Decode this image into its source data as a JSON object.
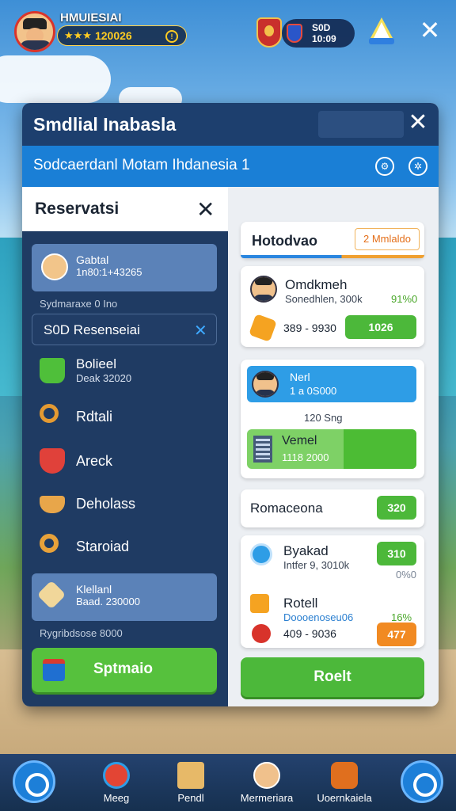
{
  "hud": {
    "player_name": "HMUIESIAI",
    "stars": "★★★",
    "rating_value": "120026",
    "currency_top": "S0D",
    "currency_bottom": "10:09"
  },
  "panel": {
    "title": "Smdlial Inabasla",
    "subtitle": "Sodcaerdanl Motam Ihdanesia 1"
  },
  "reservation": {
    "title": "Reservatsi",
    "profile_name": "Gabtal",
    "profile_detail": "1n80:1+43265",
    "hint": "Sydmaraxe 0 Ino",
    "search_value": "S0D Resenseiai",
    "menu": [
      {
        "label": "Bolieel",
        "sub": "Deak 32020"
      },
      {
        "label": "Rdtali"
      },
      {
        "label": "Areck"
      },
      {
        "label": "Deholass"
      },
      {
        "label": "Staroiad"
      }
    ],
    "highlight_name": "Klellanl",
    "highlight_detail": "Baad. 230000",
    "footer_note": "Rygribdsose 8000",
    "confirm_button": "Sptmaio"
  },
  "hotels": {
    "header_title": "Hotodvao",
    "header_badge": "2 Mmlaldo",
    "card1_name": "Omdkmeh",
    "card1_detail": "Sonedhlen, 300k",
    "card1_percent": "91%0",
    "card1_range": "389 - 9930",
    "card1_button": "1026",
    "card2_name": "Nerl",
    "card2_detail": "1 a 0S000",
    "card2_note": "120 Sng",
    "card2_sub_name": "Vemel",
    "card2_sub_detail": "1118 2000",
    "section_title": "Romaceona",
    "section_button": "320",
    "item1_name": "Byakad",
    "item1_detail": "Intfer 9, 3010k",
    "item1_percent": "0%0",
    "item1_button": "310",
    "item2_name": "Rotell",
    "item2_detail": "Doooenoseu06",
    "item2_percent": "16%",
    "item2_range": "409 - 9036",
    "item2_button": "477",
    "book_button": "Roelt"
  },
  "bottom_nav": [
    {
      "label": "Meeg"
    },
    {
      "label": "Pendl"
    },
    {
      "label": "Mermeriara"
    },
    {
      "label": "Uoernkaiela"
    }
  ],
  "icons": {
    "settings": "gear-icon",
    "compass": "compass-icon",
    "close": "close-icon"
  },
  "colors": {
    "header": "#1d3f6e",
    "accent_blue": "#1a7fd6",
    "accent_green": "#4cb83a",
    "accent_orange": "#f18a22"
  }
}
